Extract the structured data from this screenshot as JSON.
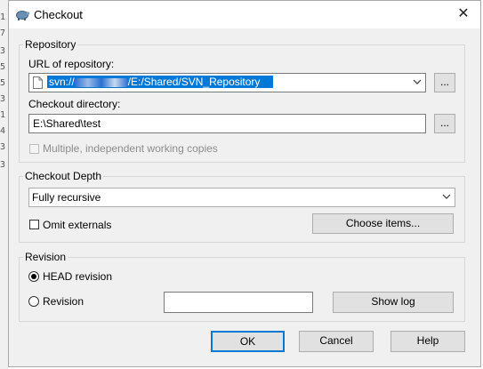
{
  "background_digits": [
    "1",
    "7",
    "3",
    "5",
    "5",
    "3",
    "1",
    "4",
    "3",
    "3"
  ],
  "dialog": {
    "title": "Checkout",
    "close_glyph": "✕",
    "accent_color": "#0078d7"
  },
  "repository": {
    "legend": "Repository",
    "url_label": "URL of repository:",
    "url_prefix": "svn://",
    "url_suffix": "/E:/Shared/SVN_Repository",
    "browse_label": "...",
    "dir_label": "Checkout directory:",
    "dir_value": "E:\\Shared\\test",
    "dir_browse_label": "...",
    "multi_wc_label": "Multiple, independent working copies"
  },
  "depth": {
    "legend": "Checkout Depth",
    "selected": "Fully recursive",
    "omit_label": "Omit externals",
    "choose_label": "Choose items..."
  },
  "revision": {
    "legend": "Revision",
    "head_label": "HEAD revision",
    "rev_label": "Revision",
    "rev_value": "",
    "show_log_label": "Show log"
  },
  "footer": {
    "ok_label": "OK",
    "cancel_label": "Cancel",
    "help_label": "Help"
  }
}
